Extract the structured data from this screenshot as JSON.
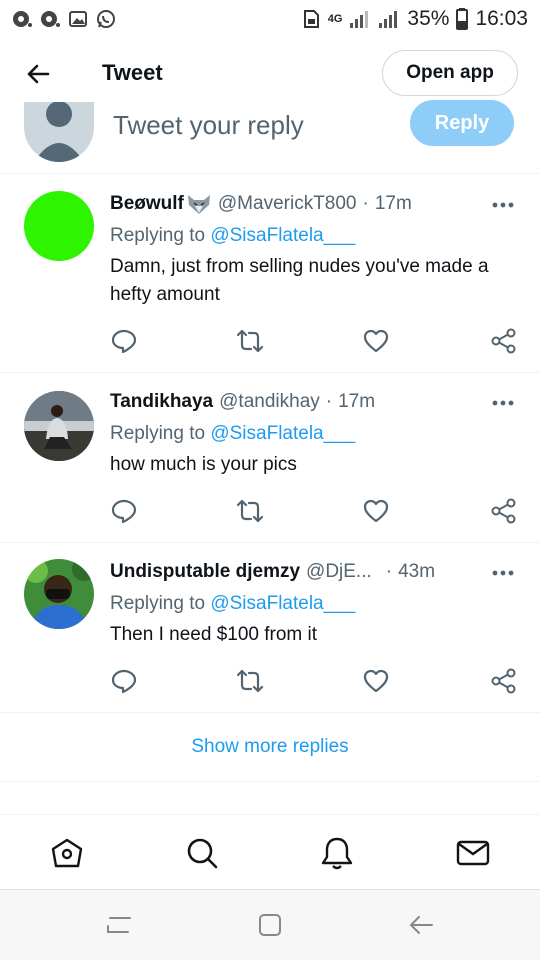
{
  "status_bar": {
    "network": "4G",
    "battery": "35%",
    "time": "16:03",
    "icons": [
      "recorder-icon",
      "recorder-icon",
      "gallery-icon",
      "whatsapp-icon",
      "sim-icon",
      "signal-icon",
      "signal-icon",
      "battery-icon"
    ]
  },
  "header": {
    "title": "Tweet",
    "open_app": "Open app"
  },
  "compose": {
    "placeholder": "Tweet your reply",
    "reply_label": "Reply"
  },
  "tweets": [
    {
      "name": "Beøwulf",
      "name_emoji": "wolf-emoji",
      "handle": "@MaverickT800",
      "time": "17m",
      "replying_prefix": "Replying to",
      "replying_to": "@SisaFlatela___",
      "text": "Damn, just from selling nudes you've made a hefty amount",
      "avatar_color": "#2ef400"
    },
    {
      "name": "Tandikhaya",
      "handle": "@tandikhay",
      "time": "17m",
      "replying_prefix": "Replying to",
      "replying_to": "@SisaFlatela___",
      "text": "how much is your pics"
    },
    {
      "name": "Undisputable djemzy",
      "handle": "@DjE...",
      "time": "43m",
      "replying_prefix": "Replying to",
      "replying_to": "@SisaFlatela___",
      "text": "Then I need $100 from it"
    }
  ],
  "show_more": "Show more replies",
  "bottom_nav": [
    "home-icon",
    "search-icon",
    "notifications-icon",
    "messages-icon"
  ],
  "colors": {
    "accent": "#1d9bf0",
    "reply_button": "#8ecdf8",
    "secondary_text": "#536471",
    "divider": "#eff3f4"
  }
}
